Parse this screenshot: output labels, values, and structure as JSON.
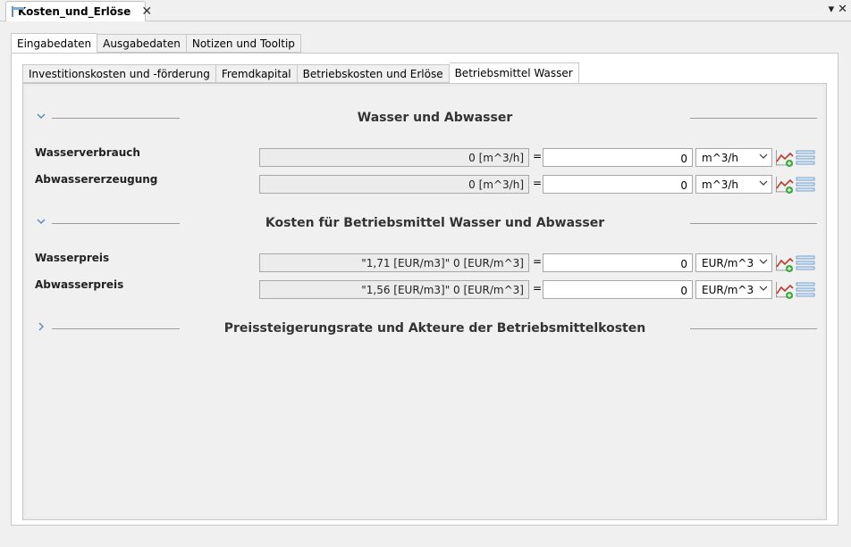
{
  "editor_tab": {
    "title": "Kosten_und_Erlöse",
    "close": "✕"
  },
  "window_controls": {
    "menu": "▾",
    "close": "✕"
  },
  "main_tabs": [
    {
      "label": "Eingabedaten",
      "active": true
    },
    {
      "label": "Ausgabedaten",
      "active": false
    },
    {
      "label": "Notizen und Tooltip",
      "active": false
    }
  ],
  "inner_tabs": [
    {
      "label": "Investitionskosten und -förderung",
      "active": false
    },
    {
      "label": "Fremdkapital",
      "active": false
    },
    {
      "label": "Betriebskosten und Erlöse",
      "active": false
    },
    {
      "label": "Betriebsmittel Wasser",
      "active": true
    }
  ],
  "sections": [
    {
      "title": "Wasser und Abwasser",
      "expanded": true,
      "rows": [
        {
          "label": "Wasserverbrauch",
          "readonly": "0 [m^3/h]",
          "eq": "=",
          "value": "0",
          "unit": "m^3/h"
        },
        {
          "label": "Abwassererzeugung",
          "readonly": "0 [m^3/h]",
          "eq": "=",
          "value": "0",
          "unit": "m^3/h"
        }
      ]
    },
    {
      "title": "Kosten für Betriebsmittel Wasser und Abwasser",
      "expanded": true,
      "rows": [
        {
          "label": "Wasserpreis",
          "readonly": "\"1,71 [EUR/m3]\" 0 [EUR/m^3]",
          "eq": "=",
          "value": "0",
          "unit": "EUR/m^3"
        },
        {
          "label": "Abwasserpreis",
          "readonly": "\"1,56 [EUR/m3]\" 0 [EUR/m^3]",
          "eq": "=",
          "value": "0",
          "unit": "EUR/m^3"
        }
      ]
    },
    {
      "title": "Preissteigerungsrate und Akteure der Betriebsmittelkosten",
      "expanded": false,
      "rows": []
    }
  ],
  "icons": {
    "chevron_expanded": "chevron-down-icon",
    "chevron_collapsed": "chevron-right-icon",
    "dropdown": "chevron-down-icon",
    "chart": "chart-add-icon",
    "list": "list-icon"
  },
  "colors": {
    "chevron": "#5c86b8",
    "chart_line": "#c0392b",
    "chart_add": "#3aa83a",
    "list_lines": "#5a8fc9"
  }
}
